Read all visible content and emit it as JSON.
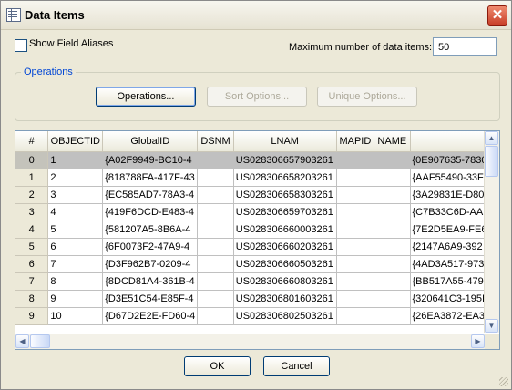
{
  "window": {
    "title": "Data Items",
    "close_symbol": "✕"
  },
  "options": {
    "show_field_aliases_label": "Show Field Aliases",
    "show_field_aliases_checked": false,
    "max_items_label": "Maximum number of data items:",
    "max_items_value": "50"
  },
  "operations": {
    "group_label": "Operations",
    "operations_button": "Operations...",
    "sort_button": "Sort Options...",
    "unique_button": "Unique Options..."
  },
  "table": {
    "columns": [
      "#",
      "OBJECTID",
      "GlobalID",
      "DSNM",
      "LNAM",
      "MAPID",
      "NAME",
      ""
    ],
    "rows": [
      {
        "n": "0",
        "objectid": "1",
        "globalid": "{A02F9949-BC10-4",
        "dsnm": "",
        "lnam": "US028306657903261",
        "mapid": "",
        "name": "",
        "extra": "{0E907635-7830"
      },
      {
        "n": "1",
        "objectid": "2",
        "globalid": "{818788FA-417F-43",
        "dsnm": "",
        "lnam": "US028306658203261",
        "mapid": "",
        "name": "",
        "extra": "{AAF55490-33F"
      },
      {
        "n": "2",
        "objectid": "3",
        "globalid": "{EC585AD7-78A3-4",
        "dsnm": "",
        "lnam": "US028306658303261",
        "mapid": "",
        "name": "",
        "extra": "{3A29831E-D80"
      },
      {
        "n": "3",
        "objectid": "4",
        "globalid": "{419F6DCD-E483-4",
        "dsnm": "",
        "lnam": "US028306659703261",
        "mapid": "",
        "name": "",
        "extra": "{C7B33C6D-AA"
      },
      {
        "n": "4",
        "objectid": "5",
        "globalid": "{581207A5-8B6A-4",
        "dsnm": "",
        "lnam": "US028306660003261",
        "mapid": "",
        "name": "",
        "extra": "{7E2D5EA9-FE6"
      },
      {
        "n": "5",
        "objectid": "6",
        "globalid": "{6F0073F2-47A9-4",
        "dsnm": "",
        "lnam": "US028306660203261",
        "mapid": "",
        "name": "",
        "extra": "{2147A6A9-392"
      },
      {
        "n": "6",
        "objectid": "7",
        "globalid": "{D3F962B7-0209-4",
        "dsnm": "",
        "lnam": "US028306660503261",
        "mapid": "",
        "name": "",
        "extra": "{4AD3A517-973"
      },
      {
        "n": "7",
        "objectid": "8",
        "globalid": "{8DCD81A4-361B-4",
        "dsnm": "",
        "lnam": "US028306660803261",
        "mapid": "",
        "name": "",
        "extra": "{BB517A55-479"
      },
      {
        "n": "8",
        "objectid": "9",
        "globalid": "{D3E51C54-E85F-4",
        "dsnm": "",
        "lnam": "US028306801603261",
        "mapid": "",
        "name": "",
        "extra": "{320641C3-195I"
      },
      {
        "n": "9",
        "objectid": "10",
        "globalid": "{D67D2E2E-FD60-4",
        "dsnm": "",
        "lnam": "US028306802503261",
        "mapid": "",
        "name": "",
        "extra": "{26EA3872-EA3"
      }
    ],
    "selected_row": 0
  },
  "footer": {
    "ok_button": "OK",
    "cancel_button": "Cancel"
  }
}
